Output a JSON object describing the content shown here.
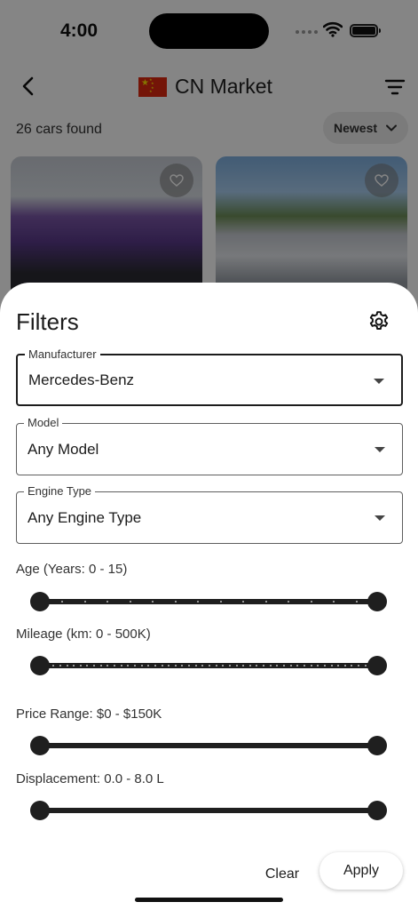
{
  "status_bar": {
    "time": "4:00"
  },
  "app_bar": {
    "title": "CN Market",
    "flag": "china-flag"
  },
  "results": {
    "count_text": "26 cars found",
    "sort_label": "Newest"
  },
  "cards": [
    {
      "color": "purple supercar"
    },
    {
      "color": "white supercar"
    }
  ],
  "filters": {
    "title": "Filters",
    "manufacturer": {
      "label": "Manufacturer",
      "value": "Mercedes-Benz"
    },
    "model": {
      "label": "Model",
      "value": "Any Model"
    },
    "engine_type": {
      "label": "Engine Type",
      "value": "Any Engine Type"
    },
    "age": {
      "label": "Age (Years: 0 - 15)",
      "min": 0,
      "max": 15,
      "ticks": 15
    },
    "mileage": {
      "label": "Mileage (km: 0 - 500K)",
      "min": 0,
      "max": 500,
      "ticks": 50
    },
    "price": {
      "label": "Price Range: $0 - $150K",
      "min": 0,
      "max": 150
    },
    "displacement": {
      "label": "Displacement: 0.0 - 8.0 L",
      "min": 0.0,
      "max": 8.0
    },
    "clear_label": "Clear",
    "apply_label": "Apply"
  },
  "colors": {
    "accent": "#1f1f1f",
    "flag_red": "#de2910",
    "flag_yellow": "#ffde00"
  }
}
